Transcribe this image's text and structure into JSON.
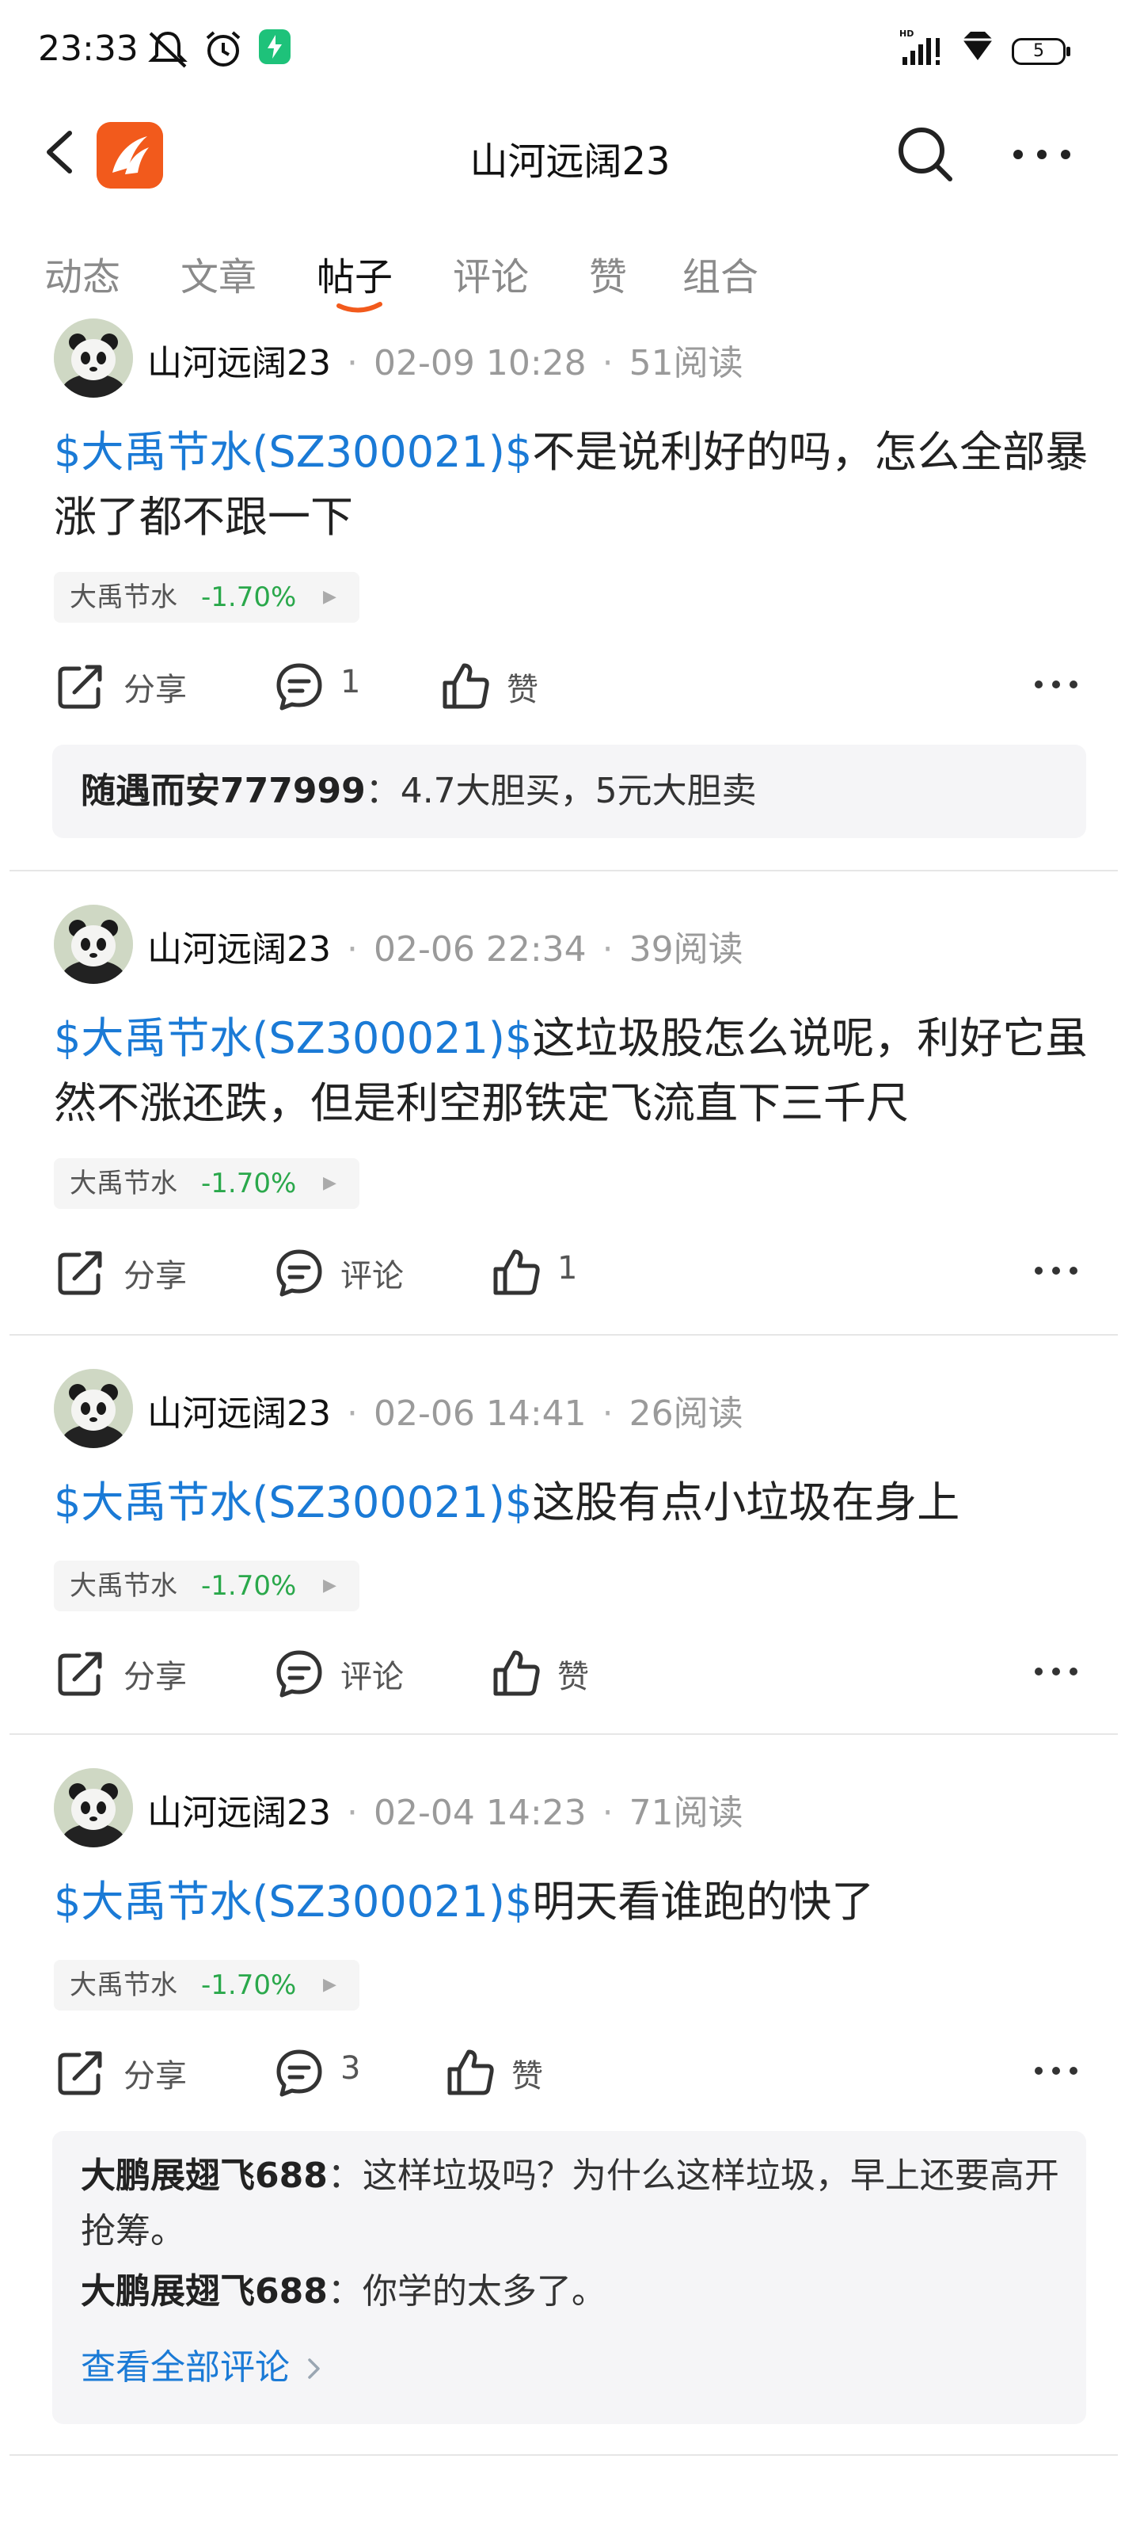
{
  "status_bar": {
    "time": "23:33",
    "battery": "5"
  },
  "header": {
    "title": "山河远阔23"
  },
  "tabs": [
    {
      "label": "动态"
    },
    {
      "label": "文章"
    },
    {
      "label": "帖子"
    },
    {
      "label": "评论"
    },
    {
      "label": "赞"
    },
    {
      "label": "组合"
    }
  ],
  "active_tab": "帖子",
  "colors": {
    "accent": "#1a7ad6",
    "brand": "#f25a1c",
    "down": "#2aa84b"
  },
  "posts": [
    {
      "author": "山河远阔23",
      "time": "02-09 10:28",
      "reads": "51阅读",
      "stock_link": "$大禹节水(SZ300021)$",
      "text": "不是说利好的吗，怎么全部暴涨了都不跟一下",
      "stock_name": "大禹节水",
      "stock_change": "-1.70%",
      "share_label": "分享",
      "comment_label": "1",
      "like_label": "赞",
      "comments": [
        {
          "user": "随遇而安777999",
          "text": "4.7大胆买，5元大胆卖"
        }
      ]
    },
    {
      "author": "山河远阔23",
      "time": "02-06 22:34",
      "reads": "39阅读",
      "stock_link": "$大禹节水(SZ300021)$",
      "text": "这垃圾股怎么说呢，利好它虽然不涨还跌，但是利空那铁定飞流直下三千尺",
      "stock_name": "大禹节水",
      "stock_change": "-1.70%",
      "share_label": "分享",
      "comment_label": "评论",
      "like_label": "1"
    },
    {
      "author": "山河远阔23",
      "time": "02-06 14:41",
      "reads": "26阅读",
      "stock_link": "$大禹节水(SZ300021)$",
      "text": "这股有点小垃圾在身上",
      "stock_name": "大禹节水",
      "stock_change": "-1.70%",
      "share_label": "分享",
      "comment_label": "评论",
      "like_label": "赞"
    },
    {
      "author": "山河远阔23",
      "time": "02-04 14:23",
      "reads": "71阅读",
      "stock_link": "$大禹节水(SZ300021)$",
      "text": "明天看谁跑的快了",
      "stock_name": "大禹节水",
      "stock_change": "-1.70%",
      "share_label": "分享",
      "comment_label": "3",
      "like_label": "赞",
      "comments": [
        {
          "user": "大鹏展翅飞688",
          "text": "这样垃圾吗？为什么这样垃圾，早上还要高开抢筹。"
        },
        {
          "user": "大鹏展翅飞688",
          "text": "你学的太多了。"
        }
      ],
      "view_all": "查看全部评论"
    }
  ]
}
